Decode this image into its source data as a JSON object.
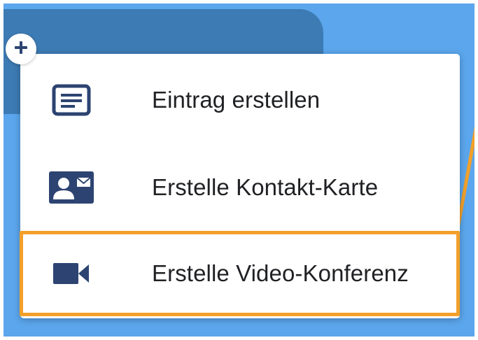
{
  "menu": {
    "items": [
      {
        "label": "Eintrag erstellen",
        "icon": "note-icon"
      },
      {
        "label": "Erstelle Kontakt-Karte",
        "icon": "contact-card-icon"
      },
      {
        "label": "Erstelle Video-Konferenz",
        "icon": "video-camera-icon"
      }
    ]
  },
  "fab": {
    "icon": "plus-icon"
  },
  "colors": {
    "background": "#5ba6ec",
    "background_card": "#3d7bb4",
    "icon": "#2d4472",
    "highlight": "#f2a02a",
    "text": "#202124"
  }
}
